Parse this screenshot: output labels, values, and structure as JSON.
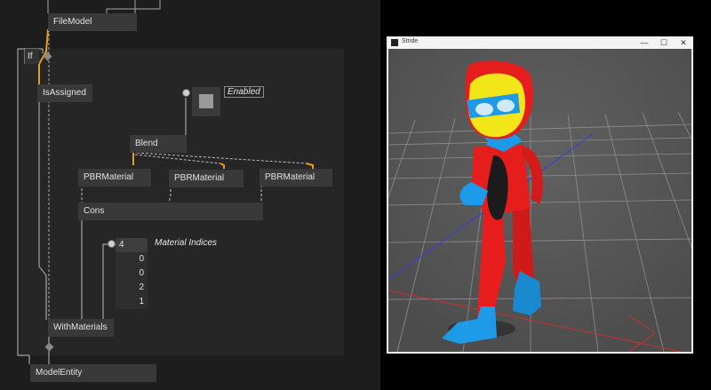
{
  "patch": {
    "nodes": {
      "file_model": "FileModel",
      "if": "If",
      "is_assigned": "IsAssigned",
      "blend": "Blend",
      "pbr_material_1": "PBRMaterial",
      "pbr_material_2": "PBRMaterial",
      "pbr_material_3": "PBRMaterial",
      "cons": "Cons",
      "with_materials": "WithMaterials",
      "model_entity": "ModelEntity"
    },
    "enabled_label": "Enabled",
    "enabled_value": true,
    "material_indices_label": "Material Indices",
    "material_indices": {
      "count": "4",
      "values": [
        "0",
        "0",
        "2",
        "1"
      ]
    }
  },
  "stride_window": {
    "title": "Stride",
    "minimize": "—",
    "maximize": "☐",
    "close": "✕"
  },
  "colors": {
    "patch_background": "#1d1d1d",
    "region_background": "#262626",
    "node_background": "#393939",
    "link_highlight": "#e3a018",
    "viewport_background": "#555555"
  }
}
